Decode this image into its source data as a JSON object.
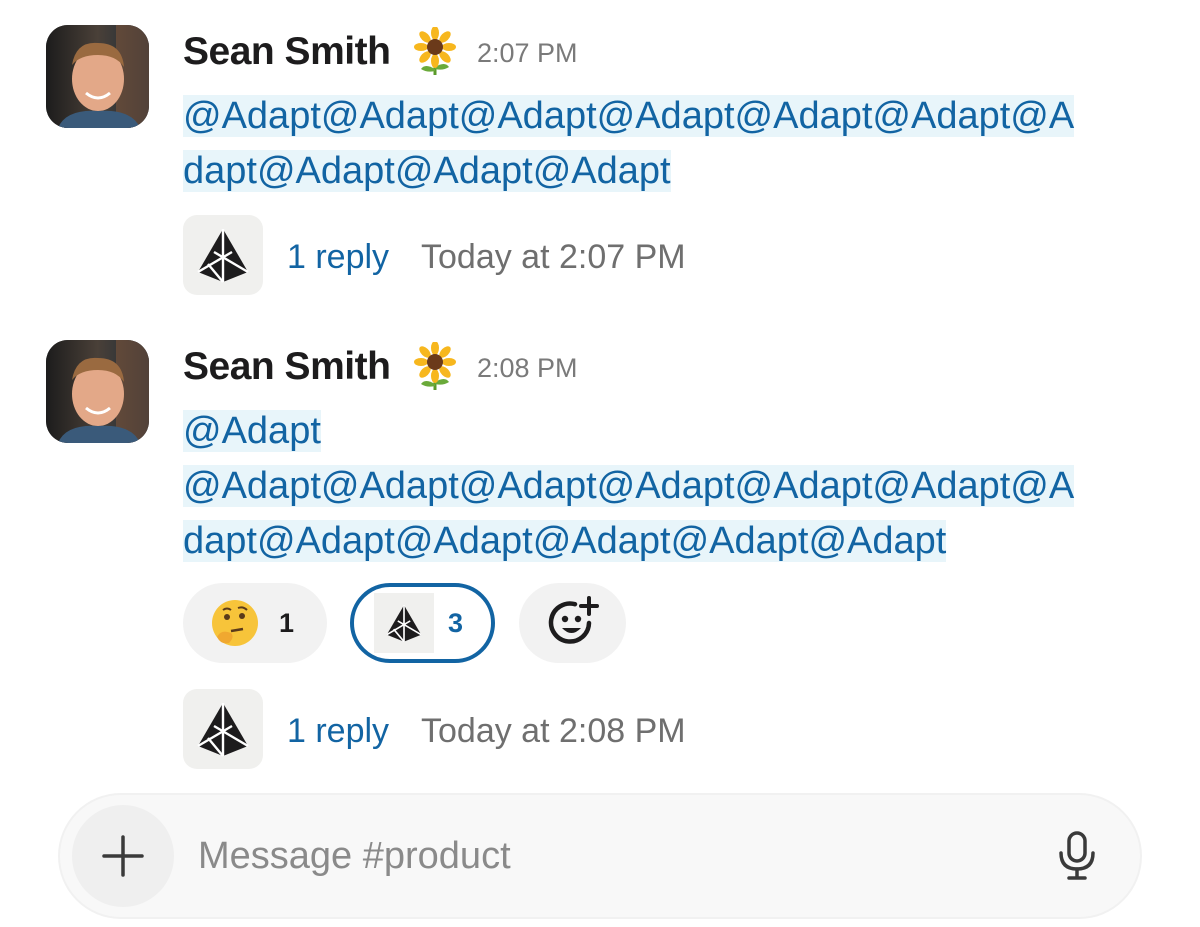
{
  "messages": [
    {
      "author": "Sean Smith",
      "status_icon": "sunflower-icon",
      "time": "2:07 PM",
      "lines": [
        "@Adapt@Adapt@Adapt@Adapt@Adapt@Adapt@A",
        "dapt@Adapt@Adapt@Adapt"
      ],
      "thread": {
        "reply_label": "1 reply",
        "reply_time": "Today at 2:07 PM"
      }
    },
    {
      "author": "Sean Smith",
      "status_icon": "sunflower-icon",
      "time": "2:08 PM",
      "lines": [
        "@Adapt",
        "@Adapt@Adapt@Adapt@Adapt@Adapt@Adapt@A",
        "dapt@Adapt@Adapt@Adapt@Adapt@Adapt"
      ],
      "reactions": [
        {
          "icon": "thinking-face-icon",
          "count": "1",
          "active": false
        },
        {
          "icon": "adapt-logo-icon",
          "count": "3",
          "active": true
        },
        {
          "icon": "add-reaction-icon"
        }
      ],
      "thread": {
        "reply_label": "1 reply",
        "reply_time": "Today at 2:08 PM"
      }
    }
  ],
  "composer": {
    "placeholder": "Message #product",
    "plus_icon": "plus-icon",
    "mic_icon": "microphone-icon"
  },
  "colors": {
    "link": "#1264a3",
    "mention_bg": "#e8f5fa"
  }
}
